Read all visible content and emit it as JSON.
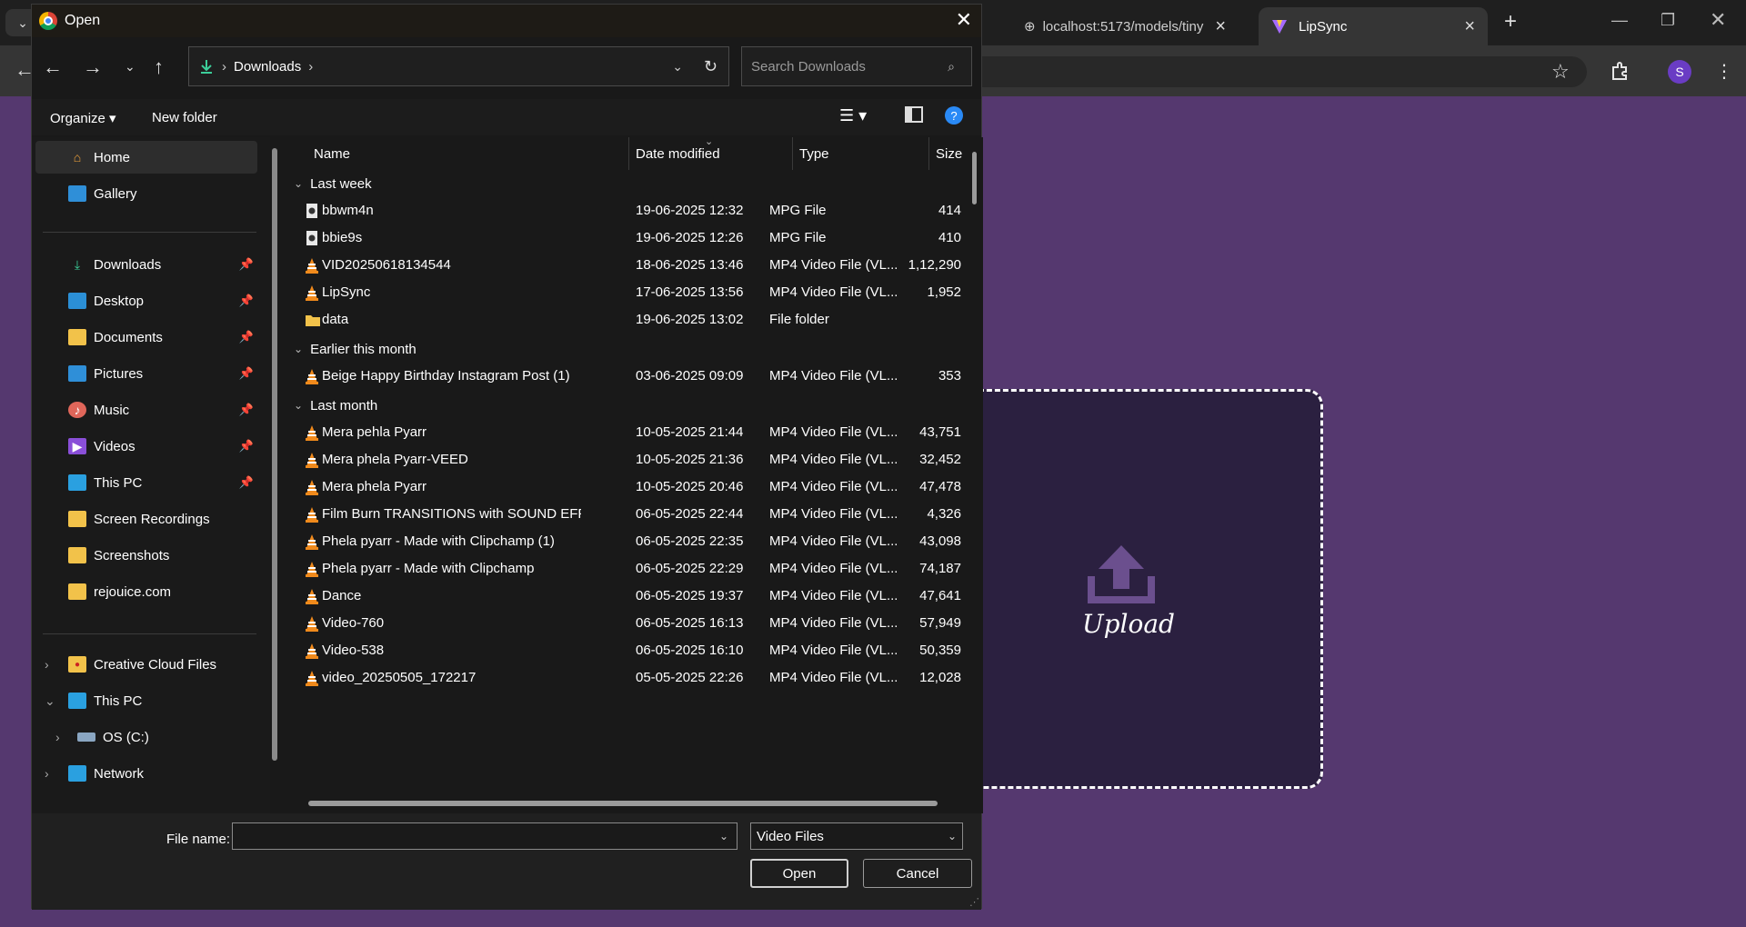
{
  "browser": {
    "tabs": [
      {
        "label": "localhost:5173/models/tiny"
      },
      {
        "label": "LipSync"
      }
    ],
    "avatar_letter": "S"
  },
  "page": {
    "upload_label": "Upload"
  },
  "dialog": {
    "title": "Open",
    "address": {
      "crumb": "Downloads"
    },
    "search_placeholder": "Search Downloads",
    "commands": {
      "organize": "Organize",
      "new_folder": "New folder"
    },
    "sidebar": {
      "top": [
        {
          "label": "Home"
        },
        {
          "label": "Gallery"
        }
      ],
      "quick": [
        {
          "label": "Downloads"
        },
        {
          "label": "Desktop"
        },
        {
          "label": "Documents"
        },
        {
          "label": "Pictures"
        },
        {
          "label": "Music"
        },
        {
          "label": "Videos"
        },
        {
          "label": "This PC"
        },
        {
          "label": "Screen Recordings"
        },
        {
          "label": "Screenshots"
        },
        {
          "label": "rejouice.com"
        }
      ],
      "tree": [
        {
          "label": "Creative Cloud Files"
        },
        {
          "label": "This PC"
        },
        {
          "label": "OS (C:)"
        },
        {
          "label": "Network"
        }
      ]
    },
    "columns": {
      "name": "Name",
      "date": "Date modified",
      "type": "Type",
      "size": "Size"
    },
    "groups": [
      {
        "label": "Last week",
        "rows": [
          {
            "name": "bbwm4n",
            "date": "19-06-2025 12:32",
            "type": "MPG File",
            "size": "414",
            "icon": "mpg"
          },
          {
            "name": "bbie9s",
            "date": "19-06-2025 12:26",
            "type": "MPG File",
            "size": "410",
            "icon": "mpg"
          },
          {
            "name": "VID20250618134544",
            "date": "18-06-2025 13:46",
            "type": "MP4 Video File (VL...",
            "size": "1,12,290",
            "icon": "vlc"
          },
          {
            "name": "LipSync",
            "date": "17-06-2025 13:56",
            "type": "MP4 Video File (VL...",
            "size": "1,952",
            "icon": "vlc"
          },
          {
            "name": "data",
            "date": "19-06-2025 13:02",
            "type": "File folder",
            "size": "",
            "icon": "folder"
          }
        ]
      },
      {
        "label": "Earlier this month",
        "rows": [
          {
            "name": "Beige Happy Birthday Instagram Post (1)",
            "date": "03-06-2025 09:09",
            "type": "MP4 Video File (VL...",
            "size": "353",
            "icon": "vlc"
          }
        ]
      },
      {
        "label": "Last month",
        "rows": [
          {
            "name": "Mera pehla Pyarr",
            "date": "10-05-2025 21:44",
            "type": "MP4 Video File (VL...",
            "size": "43,751",
            "icon": "vlc"
          },
          {
            "name": "Mera phela Pyarr-VEED",
            "date": "10-05-2025 21:36",
            "type": "MP4 Video File (VL...",
            "size": "32,452",
            "icon": "vlc"
          },
          {
            "name": "Mera phela Pyarr",
            "date": "10-05-2025 20:46",
            "type": "MP4 Video File (VL...",
            "size": "47,478",
            "icon": "vlc"
          },
          {
            "name": "Film Burn TRANSITIONS with SOUND EFF...",
            "date": "06-05-2025 22:44",
            "type": "MP4 Video File (VL...",
            "size": "4,326",
            "icon": "vlc"
          },
          {
            "name": "Phela pyarr - Made with Clipchamp (1)",
            "date": "06-05-2025 22:35",
            "type": "MP4 Video File (VL...",
            "size": "43,098",
            "icon": "vlc"
          },
          {
            "name": "Phela pyarr - Made with Clipchamp",
            "date": "06-05-2025 22:29",
            "type": "MP4 Video File (VL...",
            "size": "74,187",
            "icon": "vlc"
          },
          {
            "name": "Dance",
            "date": "06-05-2025 19:37",
            "type": "MP4 Video File (VL...",
            "size": "47,641",
            "icon": "vlc"
          },
          {
            "name": "Video-760",
            "date": "06-05-2025 16:13",
            "type": "MP4 Video File (VL...",
            "size": "57,949",
            "icon": "vlc"
          },
          {
            "name": "Video-538",
            "date": "06-05-2025 16:10",
            "type": "MP4 Video File (VL...",
            "size": "50,359",
            "icon": "vlc"
          },
          {
            "name": "video_20250505_172217",
            "date": "05-05-2025 22:26",
            "type": "MP4 Video File (VL...",
            "size": "12,028",
            "icon": "vlc"
          }
        ]
      }
    ],
    "file_name_label": "File name:",
    "file_name_value": "",
    "file_type": "Video Files",
    "open_label": "Open",
    "cancel_label": "Cancel"
  },
  "colors": {
    "page_bg": "#55386f",
    "accent": "#0a84ff",
    "vlc": "#f08a1c",
    "folder": "#f2c24a"
  }
}
